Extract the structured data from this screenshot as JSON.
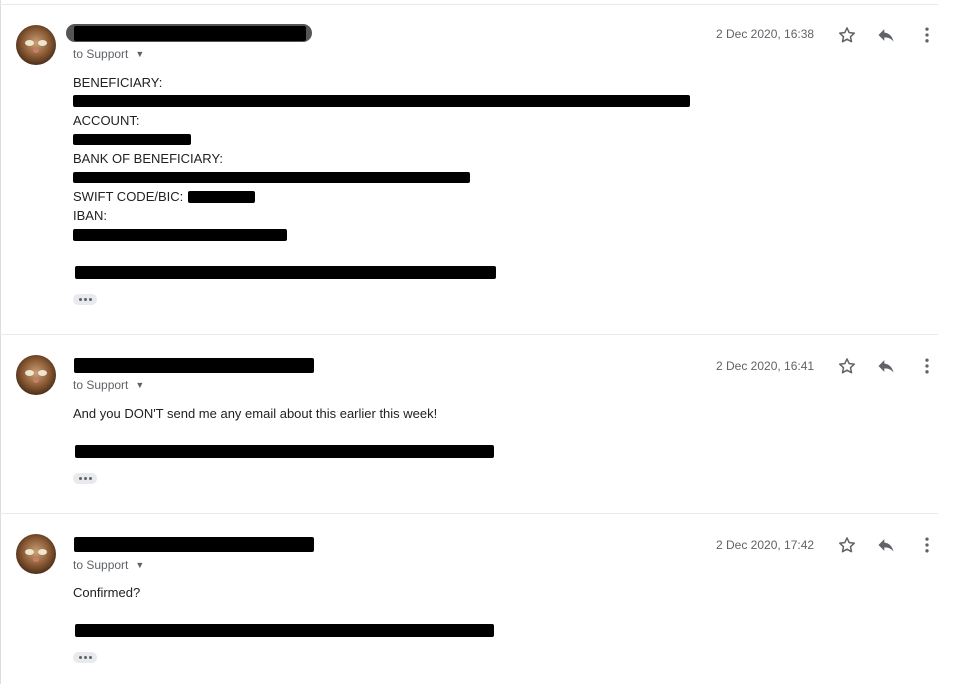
{
  "messages": [
    {
      "to_label": "to Support",
      "timestamp": "2 Dec 2020, 16:38",
      "body": {
        "beneficiary_label": "BENEFICIARY:",
        "account_label": "ACCOUNT:",
        "bank_label": "BANK OF BENEFICIARY:",
        "swift_label": "SWIFT CODE/BIC:",
        "iban_label": "IBAN:"
      }
    },
    {
      "to_label": "to Support",
      "timestamp": "2 Dec 2020, 16:41",
      "body": {
        "text": "And you DON'T send me any email about this earlier this week!"
      }
    },
    {
      "to_label": "to Support",
      "timestamp": "2 Dec 2020, 17:42",
      "body": {
        "text": "Confirmed?"
      }
    }
  ],
  "icons": {
    "star": "star-outline-icon",
    "reply": "reply-icon",
    "more": "more-vert-icon",
    "caret": "arrow-drop-down-icon",
    "trimmed": "more-horiz-icon"
  },
  "colors": {
    "text": "#202124",
    "secondary": "#5f6368",
    "divider": "#e8eaed",
    "redaction": "#000000"
  }
}
